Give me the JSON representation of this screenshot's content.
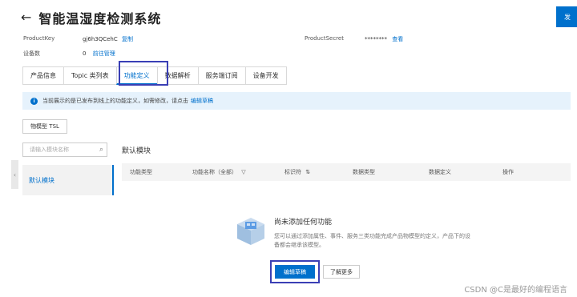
{
  "header": {
    "back_glyph": "←",
    "title": "智能温湿度检测系统",
    "publish_label": "发"
  },
  "meta": {
    "product_key_label": "ProductKey",
    "product_key_value": "gj6h3QCehC",
    "copy_label": "复制",
    "product_secret_label": "ProductSecret",
    "product_secret_value": "********",
    "view_label": "查看",
    "device_count_label": "设备数",
    "device_count_value": "0",
    "manage_label": "前往管理"
  },
  "tabs": [
    {
      "label": "产品信息",
      "active": false
    },
    {
      "label": "Topic 类列表",
      "active": false
    },
    {
      "label": "功能定义",
      "active": true
    },
    {
      "label": "数据解析",
      "active": false
    },
    {
      "label": "服务端订阅",
      "active": false
    },
    {
      "label": "设备开发",
      "active": false
    }
  ],
  "notice": {
    "icon": "i",
    "text": "当前展示的是已发布到线上的功能定义，如需修改，请点击",
    "link": "编辑草稿"
  },
  "tsl_button": "物模型 TSL",
  "sidebar": {
    "search_placeholder": "请输入模块名称",
    "search_icon": "⌕",
    "modules": [
      "默认模块"
    ],
    "collapse_icon": "‹"
  },
  "module_title": "默认模块",
  "table": {
    "columns": [
      "功能类型",
      "功能名称（全部）",
      "标识符",
      "数据类型",
      "数据定义",
      "操作"
    ],
    "filter_icon": "▽",
    "sort_icon": "⇅"
  },
  "empty_state": {
    "title": "尚未添加任何功能",
    "description": "您可以通过添加属性、事件、服务三类功能完成产品物模型的定义，产品下的设备都会继承该模型。",
    "edit_label": "编辑草稿",
    "more_label": "了解更多"
  },
  "watermark": "CSDN @C是最好的编程语言",
  "colors": {
    "accent": "#0070cc",
    "highlight_box": "#3a3fb5",
    "notice_bg": "#e6f2fc"
  }
}
